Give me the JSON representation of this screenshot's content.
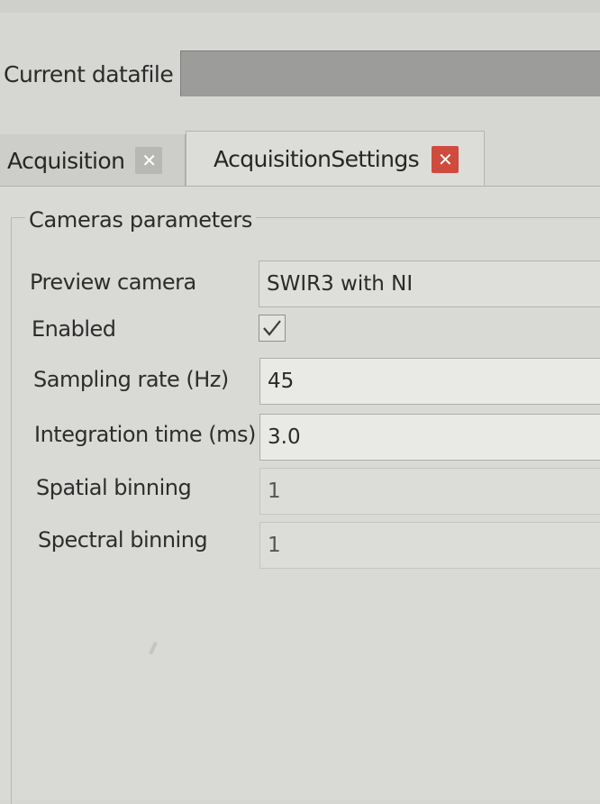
{
  "datafile": {
    "label": "Current datafile",
    "value": ""
  },
  "tabs": [
    {
      "label": "Acquisition",
      "close_icon": "close-icon",
      "active": false
    },
    {
      "label": "AcquisitionSettings",
      "close_icon": "close-icon",
      "active": true
    }
  ],
  "group": {
    "title": "Cameras parameters"
  },
  "fields": {
    "preview_camera": {
      "label": "Preview camera",
      "value": "SWIR3 with NI"
    },
    "enabled": {
      "label": "Enabled",
      "checked": true
    },
    "sampling_rate": {
      "label": "Sampling rate (Hz)",
      "value": "45"
    },
    "integration_time": {
      "label": "Integration time (ms)",
      "value": "3.0"
    },
    "spatial_binning": {
      "label": "Spatial binning",
      "value": "1"
    },
    "spectral_binning": {
      "label": "Spectral binning",
      "value": "1"
    }
  },
  "colors": {
    "active_close": "#cf4b3e",
    "inactive_close": "#b7b8b4",
    "datafile_field": "#9c9d9a"
  }
}
